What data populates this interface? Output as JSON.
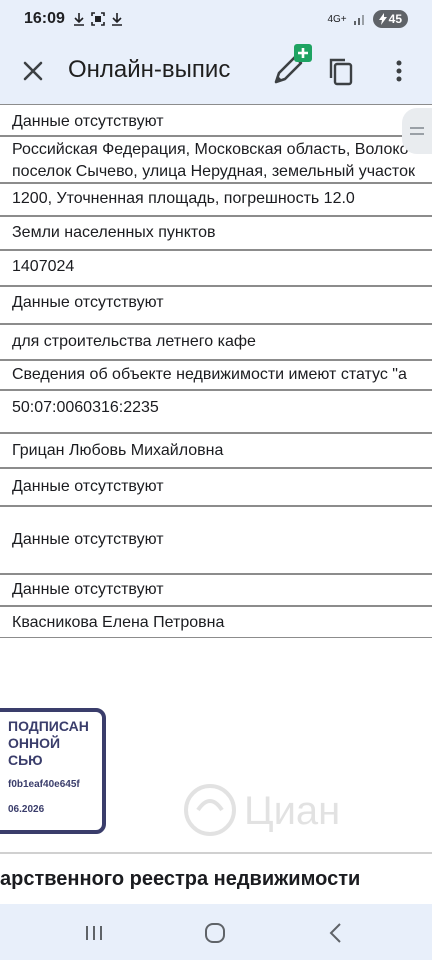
{
  "status_bar": {
    "time": "16:09",
    "left_icons": [
      "download-icon",
      "screenshot-icon",
      "download-icon"
    ],
    "network": "4G+",
    "battery": "45"
  },
  "toolbar": {
    "title": "Онлайн-выпис",
    "icons": [
      "close-icon",
      "edit-add-icon",
      "copy-icon",
      "more-vert-icon"
    ]
  },
  "rows": [
    {
      "lines": [
        "Данные отсутствуют"
      ]
    },
    {
      "lines": [
        "Российская Федерация, Московская область, Волоко",
        "поселок Сычево, улица Нерудная, земельный участок"
      ]
    },
    {
      "lines": [
        "1200, Уточненная площадь, погрешность 12.0"
      ]
    },
    {
      "lines": [
        "Земли населенных пунктов"
      ]
    },
    {
      "lines": [
        "1407024"
      ]
    },
    {
      "lines": [
        "Данные отсутствуют"
      ]
    },
    {
      "lines": [
        "для строительства летнего кафе"
      ]
    },
    {
      "lines": [
        "Сведения об объекте недвижимости имеют статус \"а"
      ]
    },
    {
      "lines": [
        "50:07:0060316:2235"
      ]
    },
    {
      "lines": [
        "Грицан Любовь Михайловна"
      ]
    },
    {
      "lines": [
        "Данные отсутствуют"
      ]
    },
    {
      "lines": [
        "Данные отсутствуют"
      ]
    },
    {
      "lines": [
        "Данные отсутствуют"
      ]
    },
    {
      "lines": [
        "Квасникова Елена Петровна"
      ]
    }
  ],
  "stamp": {
    "line1": "ПОДПИСАН",
    "line2": "ОННОЙ",
    "line3": "СЬЮ",
    "certificate": "f0b1eaf40e645f",
    "date": "06.2026"
  },
  "watermark_text": "Циан",
  "registry_heading": "арственного реестра недвижимости",
  "nav": {
    "icons": [
      "recent-apps-icon",
      "home-icon",
      "back-icon"
    ]
  },
  "colors": {
    "background": "#e8effa",
    "stamp": "#3a3d6b",
    "accent_add": "#1ea362"
  }
}
